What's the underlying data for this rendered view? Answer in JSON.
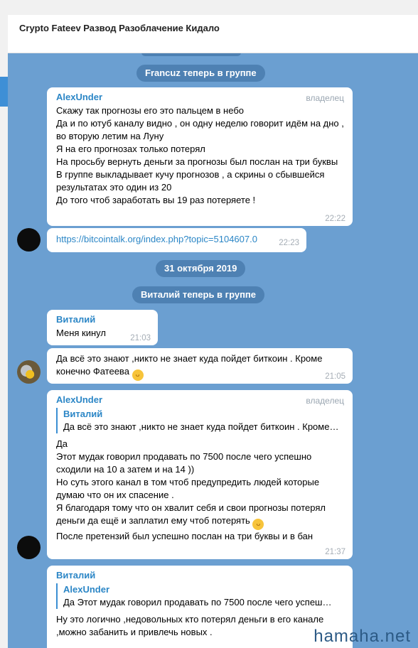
{
  "header": {
    "title": "Crypto Fateev Развод Разоблачение Кидало"
  },
  "service": {
    "joined_francuz": "Francuz теперь в группе",
    "date": "31 октября 2019",
    "joined_vitaliy": "Виталий теперь в группе"
  },
  "msg1": {
    "sender": "AlexUnder",
    "role": "владелец",
    "text": "Скажу так прогнозы его это пальцем в небо\nДа и по ютуб каналу видно , он одну неделю говорит идём на дно , во вторую летим на Луну\nЯ на его прогнозах только потерял\nНа просьбу вернуть деньги за прогнозы был послан на три буквы\nВ группе выкладывает кучу прогнозов , а скрины о сбывшейся результатах это один из 20\nДо того чтоб заработать вы 19 раз потеряете !",
    "time": "22:22"
  },
  "msg2": {
    "link": "https://bitcointalk.org/index.php?topic=5104607.0",
    "time": "22:23"
  },
  "msg3": {
    "sender": "Виталий",
    "text": "Меня кинул",
    "time": "21:03"
  },
  "msg4": {
    "text": "Да всё это знают ,никто не знает куда пойдет биткоин . Кроме конечно Фатеева",
    "emoji": "😂",
    "time": "21:05"
  },
  "msg5": {
    "sender": "AlexUnder",
    "role": "владелец",
    "quote_name": "Виталий",
    "quote_text": "Да всё это знают ,никто не знает куда пойдет биткоин . Кроме…",
    "text_a": "Да\nЭтот мудак говорил продавать по 7500 после чего успешно сходили на 10 а затем и на 14 ))\nНо суть этого канал в том чтоб предупредить людей которые думаю что он их спасение .\nЯ благодаря тому что он хвалит себя и свои прогнозы потерял деньги да ещё и заплатил ему чтоб потерять",
    "emoji": "😊",
    "text_b": "После претензий был успешно послан на три буквы и в бан",
    "time": "21:37"
  },
  "msg6": {
    "sender": "Виталий",
    "quote_name": "AlexUnder",
    "quote_text": "Да  Этот мудак говорил продавать по 7500 после чего успеш…",
    "text": "Ну это логично ,недовольных кто потерял деньги в его канале ,можно забанить и привлечь новых ."
  },
  "watermark": "hamaha.net"
}
